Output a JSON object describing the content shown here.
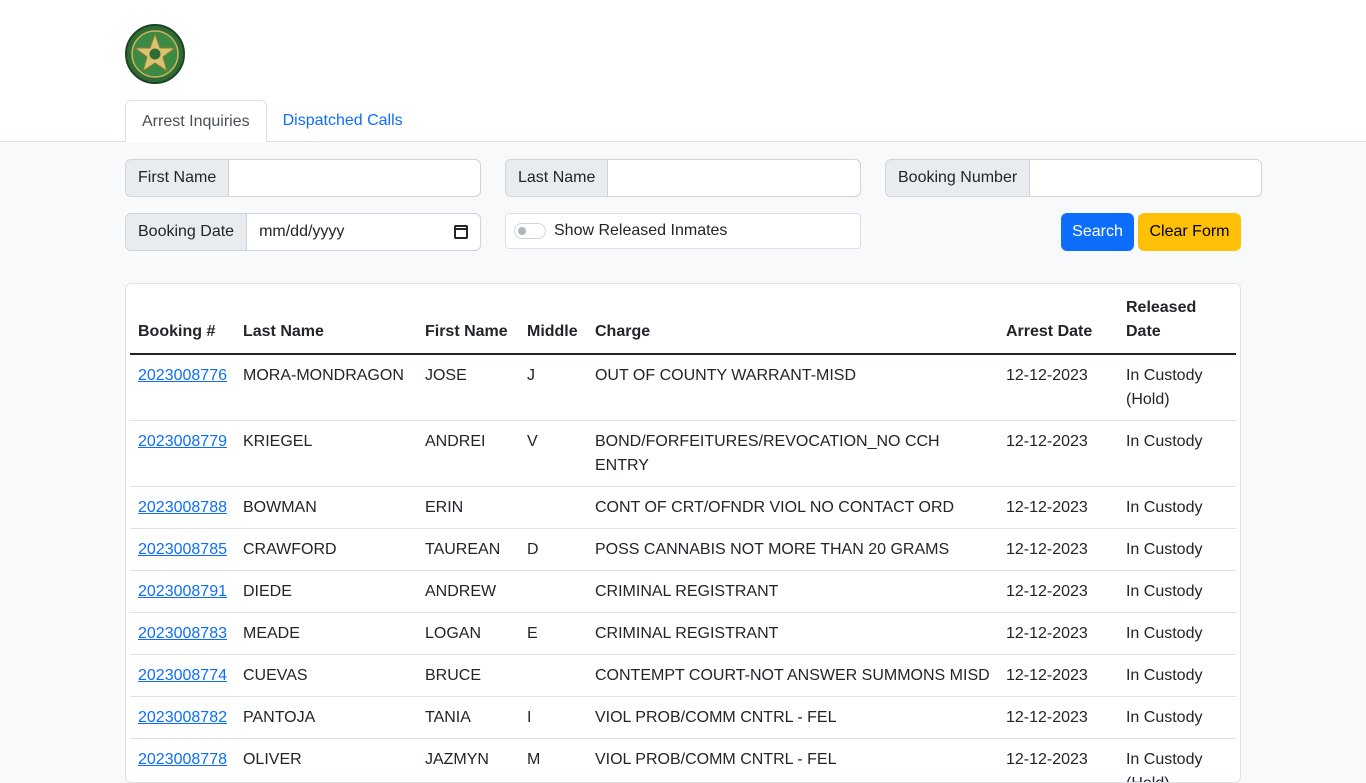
{
  "tabs": [
    "Arrest Inquiries",
    "Dispatched Calls"
  ],
  "form": {
    "first_name_label": "First Name",
    "last_name_label": "Last Name",
    "booking_number_label": "Booking Number",
    "booking_date_label": "Booking Date",
    "booking_date_placeholder": "mm/dd/yyyy",
    "show_released_label": "Show Released Inmates",
    "search_label": "Search",
    "clear_label": "Clear Form"
  },
  "table": {
    "headers": [
      "Booking #",
      "Last Name",
      "First Name",
      "Middle",
      "Charge",
      "Arrest Date",
      "Released Date"
    ],
    "rows": [
      [
        "2023008776",
        "MORA-MONDRAGON",
        "JOSE",
        "J",
        "OUT OF COUNTY WARRANT-MISD",
        "12-12-2023",
        "In Custody (Hold)"
      ],
      [
        "2023008779",
        "KRIEGEL",
        "ANDREI",
        "V",
        "BOND/FORFEITURES/REVOCATION_NO CCH ENTRY",
        "12-12-2023",
        "In Custody"
      ],
      [
        "2023008788",
        "BOWMAN",
        "ERIN",
        "",
        "CONT OF CRT/OFNDR VIOL NO CONTACT ORD",
        "12-12-2023",
        "In Custody"
      ],
      [
        "2023008785",
        "CRAWFORD",
        "TAUREAN",
        "D",
        "POSS CANNABIS NOT MORE THAN 20 GRAMS",
        "12-12-2023",
        "In Custody"
      ],
      [
        "2023008791",
        "DIEDE",
        "ANDREW",
        "",
        "CRIMINAL REGISTRANT",
        "12-12-2023",
        "In Custody"
      ],
      [
        "2023008783",
        "MEADE",
        "LOGAN",
        "E",
        "CRIMINAL REGISTRANT",
        "12-12-2023",
        "In Custody"
      ],
      [
        "2023008774",
        "CUEVAS",
        "BRUCE",
        "",
        "CONTEMPT COURT-NOT ANSWER SUMMONS MISD",
        "12-12-2023",
        "In Custody"
      ],
      [
        "2023008782",
        "PANTOJA",
        "TANIA",
        "I",
        "VIOL PROB/COMM CNTRL - FEL",
        "12-12-2023",
        "In Custody"
      ],
      [
        "2023008778",
        "OLIVER",
        "JAZMYN",
        "M",
        "VIOL PROB/COMM CNTRL - FEL",
        "12-12-2023",
        "In Custody (Hold)"
      ]
    ]
  },
  "colors": {
    "link": "#0d6efd",
    "search_button": "#0d6efd",
    "clear_button": "#ffc107"
  },
  "icons": {
    "logo": "sheriff-badge-logo",
    "date_picker": "calendar-icon"
  }
}
